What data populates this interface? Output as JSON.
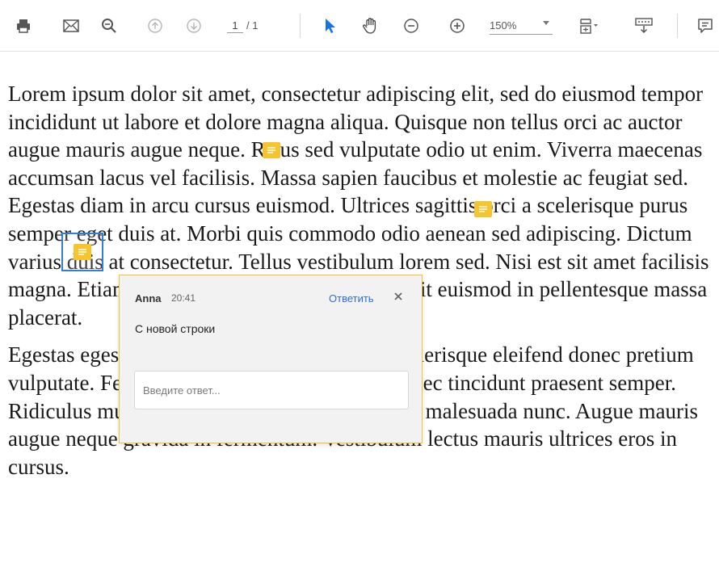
{
  "toolbar": {
    "page_current": "1",
    "page_total": "/ 1",
    "zoom": "150%",
    "icons": [
      "print-icon",
      "mail-icon",
      "search-zoom-icon",
      "page-up-icon",
      "page-down-icon",
      "select-cursor-icon",
      "hand-tool-icon",
      "zoom-out-icon",
      "zoom-in-icon",
      "fit-page-icon",
      "scroll-mode-icon",
      "comment-icon"
    ],
    "accent": "#1473e6"
  },
  "document": {
    "paragraphs": [
      "Lorem ipsum dolor sit amet, consectetur adipiscing elit, sed do eiusmod tempor incididunt ut labore et dolore magna aliqua. Quisque non tellus orci ac auctor augue mauris augue neque. Risus sed vulputate odio ut enim. Viverra maecenas accumsan lacus vel facilisis. Massa sapien faucibus et molestie ac feugiat sed. Egestas diam in arcu cursus euismod. Ultrices sagittis orci a scelerisque purus semper eget duis at. Morbi quis commodo odio aenean sed adipiscing. Dictum varius duis at consectetur. Tellus vestibulum lorem sed. Nisi est sit amet facilisis magna. Etiam tempor orci. Augue interdum velit euismod in pellentesque massa placerat.",
      "Egestas egestas fringilla phasellus faucibus scelerisque eleifend donec pretium vulputate. Feugiat in fermentum posuere urna nec tincidunt praesent semper. Ridiculus mus mauris vitae ultricies leo integer malesuada nunc. Augue mauris augue neque gravida in fermentum. Vestibulum lectus mauris ultrices eros in cursus."
    ],
    "note_color": "#f7c52b"
  },
  "comment_popup": {
    "author": "Anna",
    "time": "20:41",
    "reply_label": "Ответить",
    "text": "С новой строки",
    "reply_placeholder": "Введите ответ..."
  }
}
